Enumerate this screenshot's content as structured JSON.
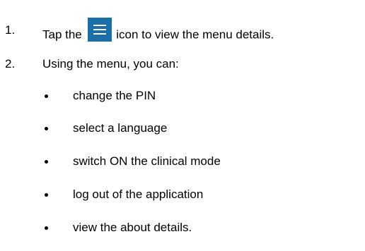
{
  "steps": [
    {
      "number": "1.",
      "text_before": "Tap the",
      "icon": "menu-icon",
      "text_after": "icon to view the menu details."
    },
    {
      "number": "2.",
      "text": "Using the menu, you can:"
    }
  ],
  "bullets": [
    "change the PIN",
    "select a language",
    "switch ON the clinical mode",
    "log out of the application",
    "view the about details."
  ],
  "colors": {
    "icon_background": "#1a6fa8",
    "icon_lines": "#ffffff",
    "text": "#000000"
  }
}
